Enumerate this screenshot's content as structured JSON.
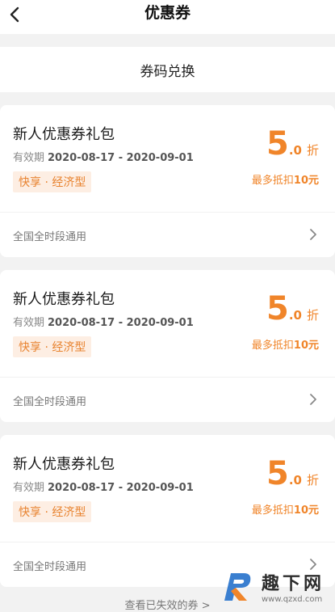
{
  "header": {
    "title": "优惠券"
  },
  "redeem": {
    "label": "券码兑换"
  },
  "coupons": [
    {
      "title": "新人优惠券礼包",
      "validity_label": "有效期",
      "validity_dates": "2020-08-17 - 2020-09-01",
      "tag": "快享 · 经济型",
      "discount_int": "5",
      "discount_dec": ".0",
      "discount_unit": "折",
      "max_prefix": "最多抵扣",
      "max_amount": "10元",
      "scope": "全国全时段通用"
    },
    {
      "title": "新人优惠券礼包",
      "validity_label": "有效期",
      "validity_dates": "2020-08-17 - 2020-09-01",
      "tag": "快享 · 经济型",
      "discount_int": "5",
      "discount_dec": ".0",
      "discount_unit": "折",
      "max_prefix": "最多抵扣",
      "max_amount": "10元",
      "scope": "全国全时段通用"
    },
    {
      "title": "新人优惠券礼包",
      "validity_label": "有效期",
      "validity_dates": "2020-08-17 - 2020-09-01",
      "tag": "快享 · 经济型",
      "discount_int": "5",
      "discount_dec": ".0",
      "discount_unit": "折",
      "max_prefix": "最多抵扣",
      "max_amount": "10元",
      "scope": "全国全时段通用"
    }
  ],
  "footer": {
    "expired_link": "查看已失效的券 >"
  },
  "watermark": {
    "name": "趣下网",
    "url": "www.qzxd.com"
  },
  "colors": {
    "accent": "#f0852a",
    "tag_bg": "#fdeee3",
    "page_bg": "#f2f2f2"
  }
}
